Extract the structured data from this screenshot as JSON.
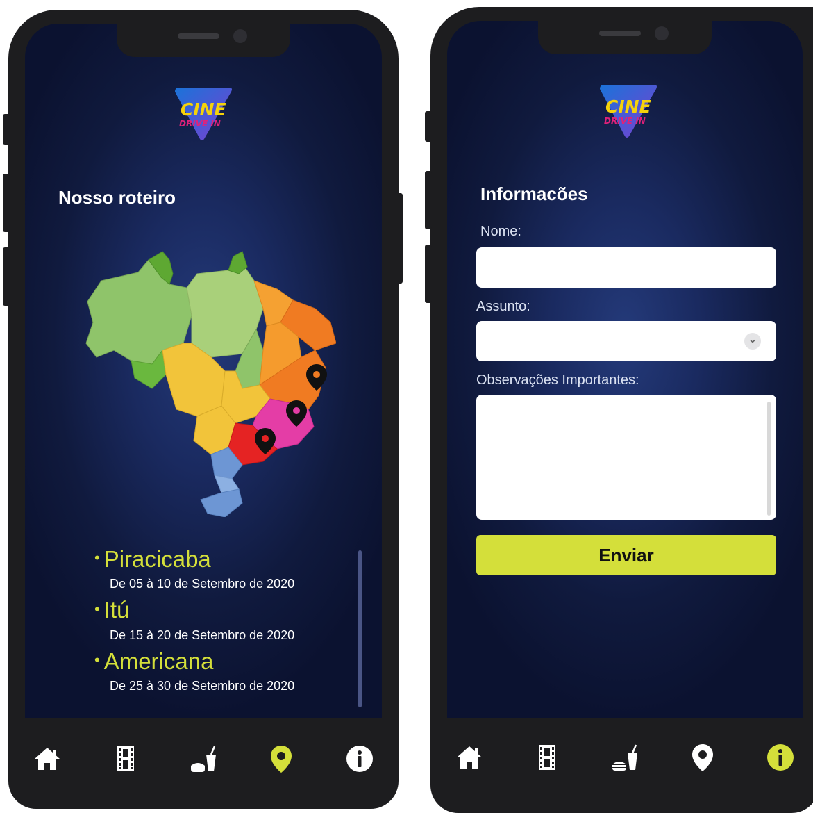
{
  "brand": {
    "logo_line1": "CINE",
    "logo_line2": "DRIVE IN",
    "colors": {
      "logo_blue": "#1a73d9",
      "logo_pink": "#e0217a",
      "logo_yellow": "#f5d20a"
    }
  },
  "route_screen": {
    "title": "Nosso roteiro",
    "map_label": "brazil-map",
    "pins": 3,
    "cities": [
      {
        "name": "Piracicaba",
        "dates": "De 05 à 10 de Setembro de 2020"
      },
      {
        "name": "Itú",
        "dates": "De 15 à 20 de Setembro de 2020"
      },
      {
        "name": "Americana",
        "dates": "De 25 à 30 de Setembro de 2020"
      }
    ],
    "active_nav": "map-pin"
  },
  "info_screen": {
    "title": "Informacões",
    "fields": {
      "name_label": "Nome:",
      "name_value": "",
      "subject_label": "Assunto:",
      "subject_value": "",
      "notes_label": "Observações Importantes:",
      "notes_value": ""
    },
    "submit_label": "Enviar",
    "active_nav": "info"
  },
  "nav": {
    "items": [
      "home-icon",
      "film-icon",
      "food-drink-icon",
      "map-pin-icon",
      "info-icon"
    ],
    "active_color": "#d4df3a",
    "inactive_color": "#ffffff",
    "bar_color": "#1d1d1f"
  },
  "theme": {
    "screen_bg_center": "#243a7a",
    "screen_bg_edge": "#0b1230",
    "accent": "#d4df3a"
  }
}
